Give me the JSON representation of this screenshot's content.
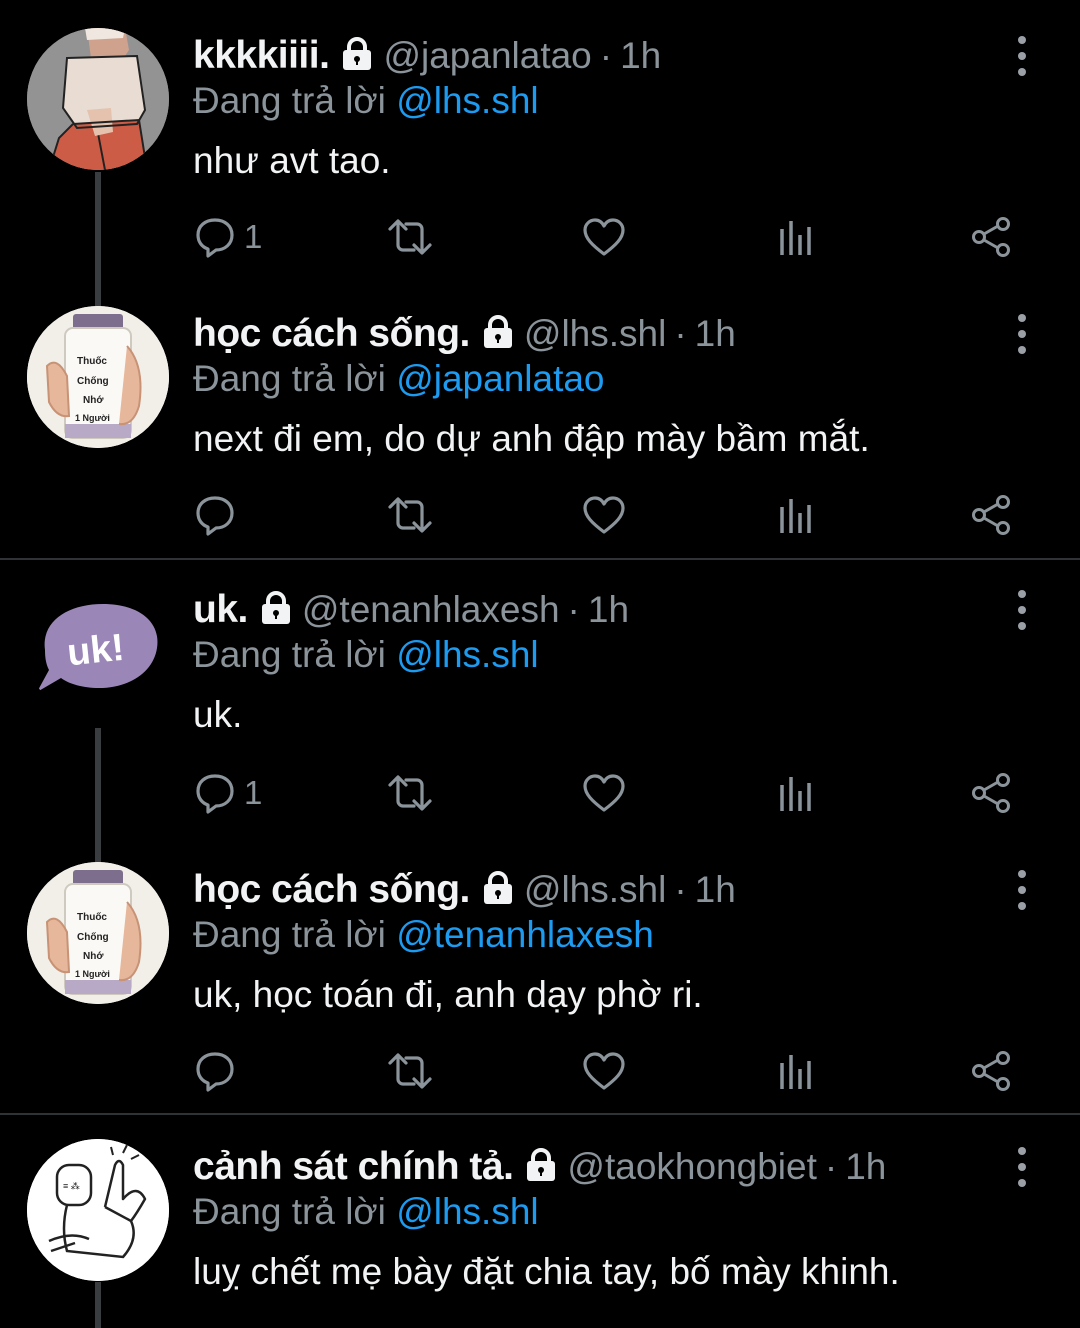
{
  "tweets": [
    {
      "name": "kkkkiiii.",
      "handle": "@japanlatao",
      "time": "1h",
      "replying_prefix": "Đang trả lời",
      "replying_to": "@lhs.shl",
      "text": "như avt tao.",
      "reply_count": "1"
    },
    {
      "name": "học cách sống.",
      "handle": "@lhs.shl",
      "time": "1h",
      "replying_prefix": "Đang trả lời",
      "replying_to": "@japanlatao",
      "text": "next đi em, do dự anh đập mày bầm mắt.",
      "reply_count": "",
      "avatar_label": [
        "Thuốc",
        "Chống",
        "Nhớ",
        "1 Người"
      ]
    },
    {
      "name": "uk.",
      "handle": "@tenanhlaxesh",
      "time": "1h",
      "replying_prefix": "Đang trả lời",
      "replying_to": "@lhs.shl",
      "text": "uk.",
      "reply_count": "1",
      "avatar_label": "uk!"
    },
    {
      "name": "học cách sống.",
      "handle": "@lhs.shl",
      "time": "1h",
      "replying_prefix": "Đang trả lời",
      "replying_to": "@tenanhlaxesh",
      "text": "uk, học toán đi, anh dạy phờ ri.",
      "reply_count": "",
      "avatar_label": [
        "Thuốc",
        "Chống",
        "Nhớ",
        "1 Người"
      ]
    },
    {
      "name": "cảnh sát chính tả.",
      "handle": "@taokhongbiet",
      "time": "1h",
      "replying_prefix": "Đang trả lời",
      "replying_to": "@lhs.shl",
      "text": "luỵ chết mẹ bày đặt chia tay, bố mày khinh."
    }
  ],
  "icons": {
    "lock": "lock-icon",
    "reply": "reply-icon",
    "retweet": "retweet-icon",
    "like": "heart-icon",
    "analytics": "analytics-icon",
    "share": "share-icon",
    "more": "more-vertical-icon"
  },
  "colors": {
    "background": "#000000",
    "mention": "#1d9bf0",
    "muted": "#8b949a",
    "text": "#f1f3f4"
  }
}
